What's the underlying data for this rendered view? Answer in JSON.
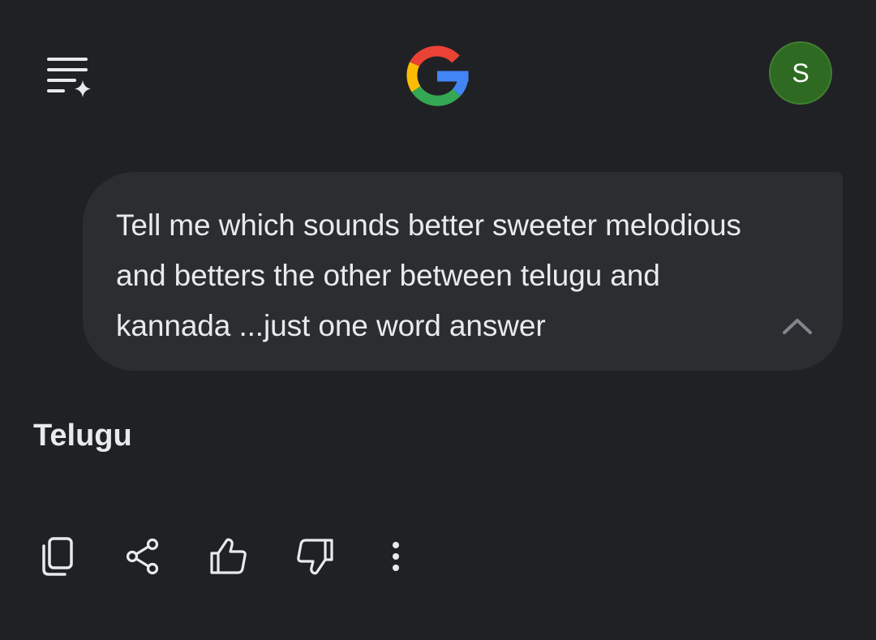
{
  "header": {
    "menu_icon": "menu-sparkle-icon",
    "logo_icon": "google-g-logo",
    "avatar_initial": "S",
    "avatar_color": "#2f6a22"
  },
  "conversation": {
    "prompt": "Tell me which sounds better sweeter melodious and betters the other between telugu and kannada ...just one word answer",
    "prompt_collapse_icon": "chevron-up-icon",
    "answer": "Telugu"
  },
  "actions": [
    {
      "name": "copy",
      "icon": "copy-icon"
    },
    {
      "name": "share",
      "icon": "share-icon"
    },
    {
      "name": "thumbs-up",
      "icon": "thumbs-up-icon"
    },
    {
      "name": "thumbs-down",
      "icon": "thumbs-down-icon"
    },
    {
      "name": "more",
      "icon": "more-vert-icon"
    }
  ],
  "colors": {
    "background": "#202124",
    "bubble": "#2b2d31",
    "text": "#e8eaed",
    "icon": "#e8eaed",
    "muted_icon": "#80868b",
    "google_blue": "#4285f4",
    "google_red": "#ea4335",
    "google_yellow": "#fbbc05",
    "google_green": "#34a853"
  }
}
